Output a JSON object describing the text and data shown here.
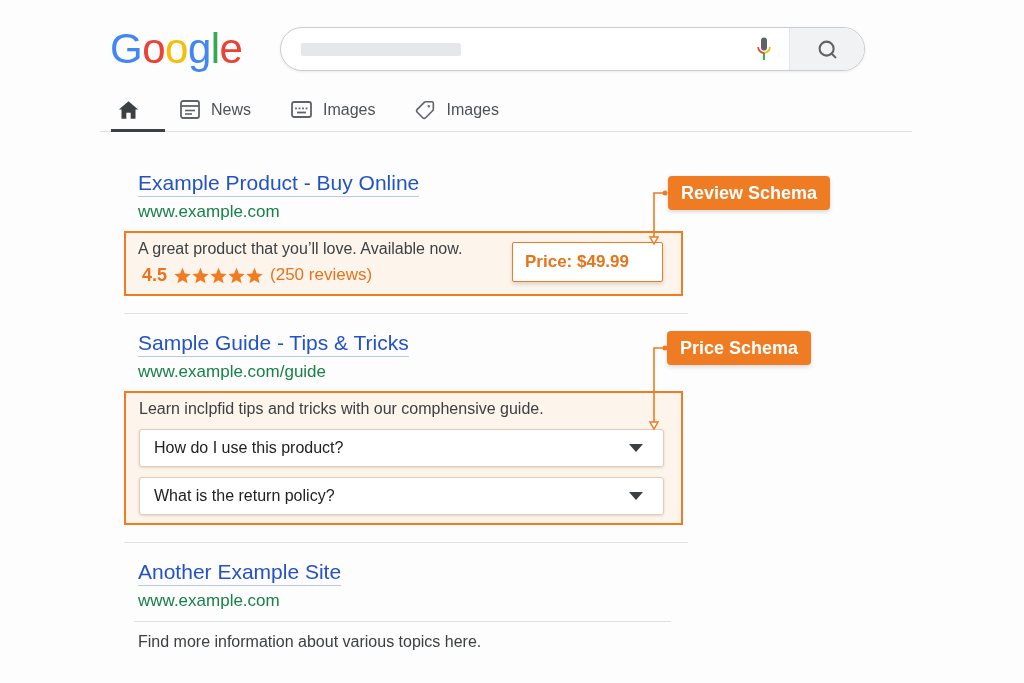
{
  "logo": {
    "text": "Google"
  },
  "tabs": [
    {
      "kind": "home",
      "selected": true
    },
    {
      "kind": "news",
      "label": "News",
      "selected": false
    },
    {
      "kind": "keyboard",
      "label": "Images",
      "selected": false
    },
    {
      "kind": "tag",
      "label": "Images",
      "selected": false
    }
  ],
  "results": [
    {
      "title": "Example Product - Buy Online",
      "url": "www.example.com",
      "schema": {
        "kind": "review",
        "callout": "Review Schema",
        "description": "A great product that you’ll love. Available now.",
        "rating": "4.5",
        "stars": 5,
        "reviews": "(250 reviews)",
        "price": "Price: $49.99"
      }
    },
    {
      "title": "Sample Guide - Tips & Tricks",
      "url": "www.example.com/guide",
      "schema": {
        "kind": "faq",
        "callout": "Price Schema",
        "description": "Learn inclpfid tips and tricks with our comphensive guide.",
        "questions": [
          {
            "text": "How do I use this product?",
            "expanded": false
          },
          {
            "text": "What is the return policy?",
            "expanded": false
          }
        ]
      }
    },
    {
      "title": "Another Example Site",
      "url": "www.example.com",
      "description": "Find more information about various topics here."
    }
  ]
}
